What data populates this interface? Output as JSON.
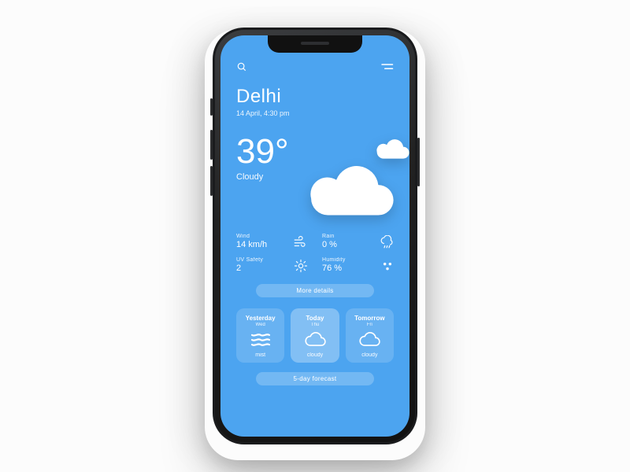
{
  "location": {
    "city": "Delhi",
    "datetime": "14 April, 4:30 pm"
  },
  "current": {
    "temp": "39°",
    "condition": "Cloudy"
  },
  "metrics": {
    "wind": {
      "label": "Wind",
      "value": "14 km/h"
    },
    "rain": {
      "label": "Rain",
      "value": "0 %"
    },
    "uv": {
      "label": "UV Safety",
      "value": "2"
    },
    "humidity": {
      "label": "Humidity",
      "value": "76 %"
    }
  },
  "buttons": {
    "more": "More details",
    "forecast": "5-day forecast"
  },
  "days": [
    {
      "title": "Yesterday",
      "date": "Wed",
      "condition": "mist",
      "icon": "mist"
    },
    {
      "title": "Today",
      "date": "Thu",
      "condition": "cloudy",
      "icon": "cloud"
    },
    {
      "title": "Tomorrow",
      "date": "Fri",
      "condition": "cloudy",
      "icon": "cloud"
    }
  ]
}
